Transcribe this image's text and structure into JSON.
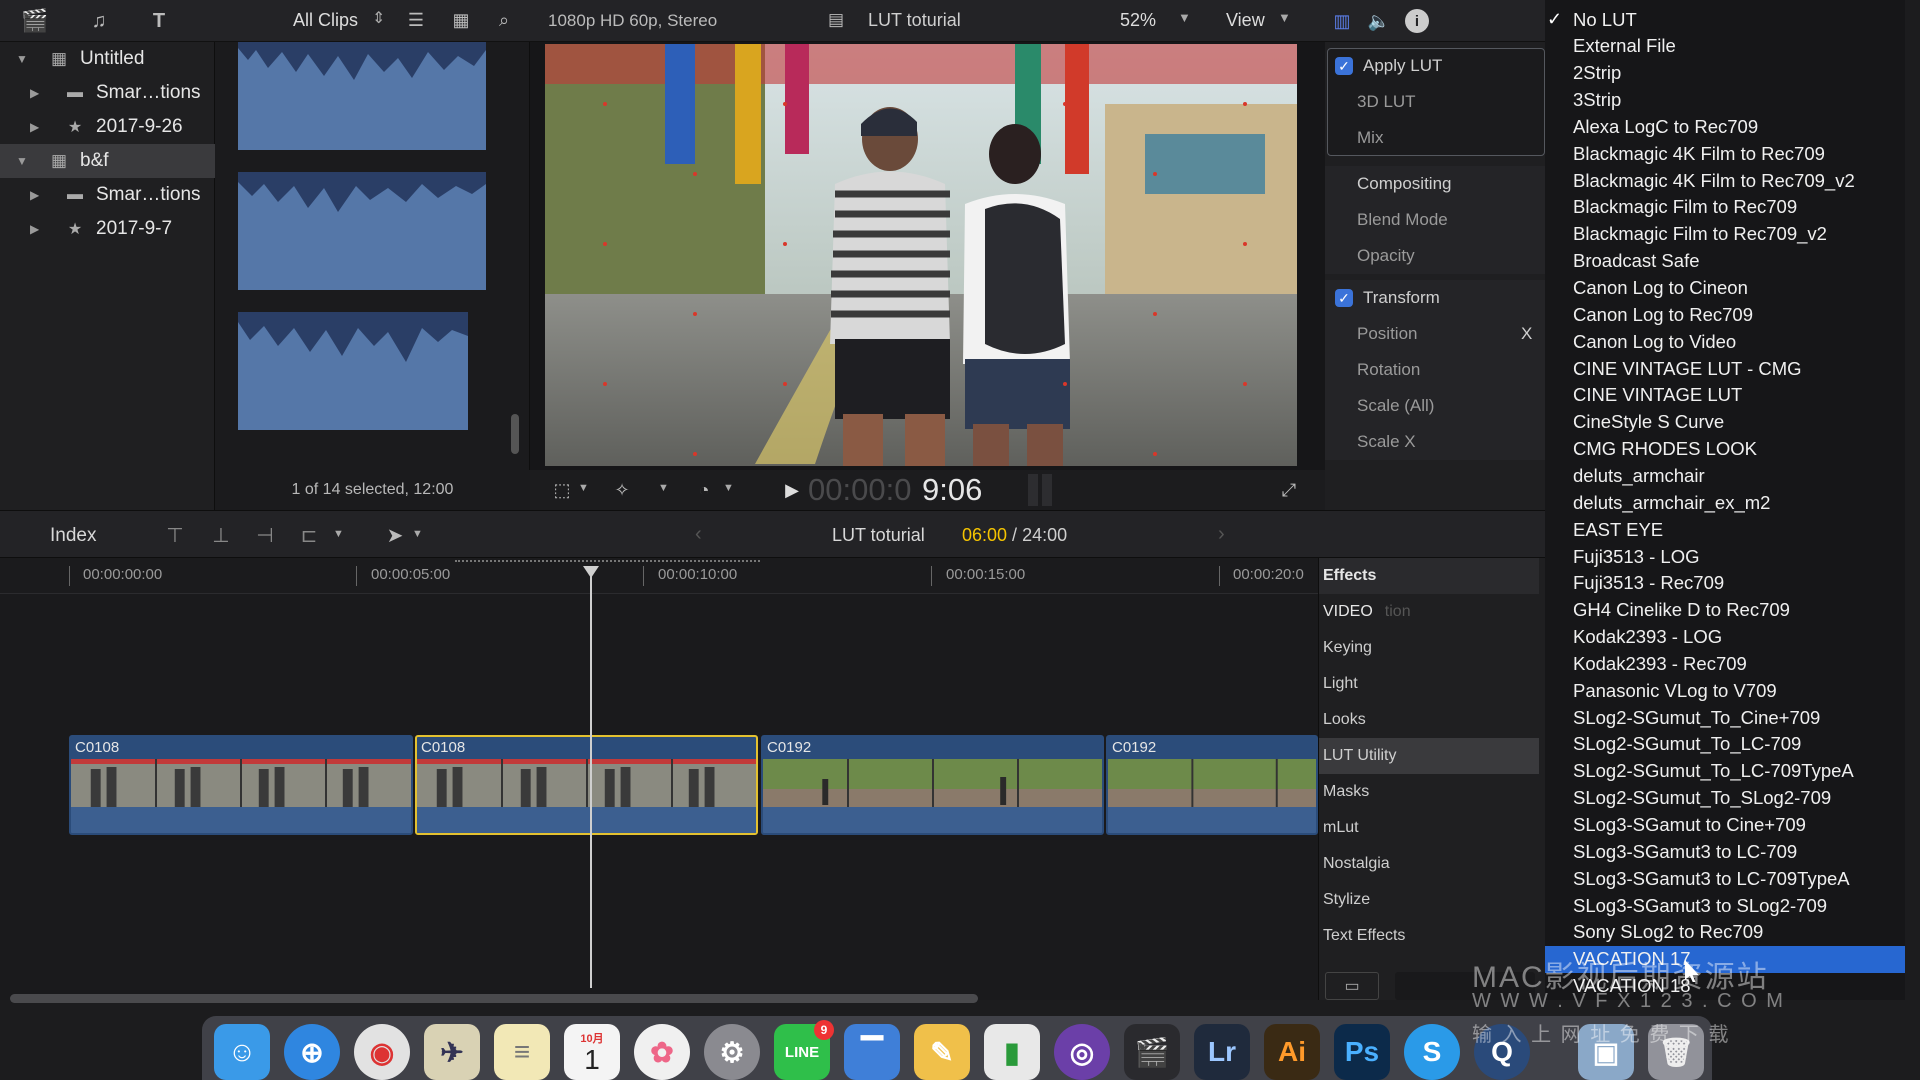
{
  "browser": {
    "filter_label": "All Clips",
    "footer": "1 of 14 selected, 12:00"
  },
  "library": {
    "items": [
      {
        "label": "Untitled",
        "icon": "library-icon"
      },
      {
        "label": "Smar…tions",
        "icon": "folder-icon"
      },
      {
        "label": "2017-9-26",
        "icon": "event-star-icon"
      },
      {
        "label": "b&f",
        "icon": "library-icon"
      },
      {
        "label": "Smar…tions",
        "icon": "folder-icon"
      },
      {
        "label": "2017-9-7",
        "icon": "event-star-icon"
      }
    ]
  },
  "viewer": {
    "format": "1080p HD 60p, Stereo",
    "project": "LUT toturial",
    "zoom": "52%",
    "view_label": "View",
    "timecode_dim": "00:00:0",
    "timecode_bright": "9:06"
  },
  "inspector": {
    "rows": [
      {
        "label": "Apply LUT",
        "checked": true
      },
      {
        "label": "3D LUT"
      },
      {
        "label": "Mix"
      },
      {
        "label": "Compositing"
      },
      {
        "label": "Blend Mode"
      },
      {
        "label": "Opacity"
      },
      {
        "label": "Transform",
        "checked": true
      },
      {
        "label": "Position",
        "value": "X"
      },
      {
        "label": "Rotation"
      },
      {
        "label": "Scale (All)"
      },
      {
        "label": "Scale X"
      }
    ]
  },
  "timeline": {
    "index_label": "Index",
    "project": "LUT toturial",
    "position": "06:00",
    "separator": " / ",
    "duration": "24:00",
    "ticks": [
      "00:00:00:00",
      "00:00:05:00",
      "00:00:10:00",
      "00:00:15:00",
      "00:00:20:0"
    ],
    "clips": [
      {
        "name": "C0108",
        "selected": false
      },
      {
        "name": "C0108",
        "selected": true
      },
      {
        "name": "C0192",
        "selected": false
      },
      {
        "name": "C0192",
        "selected": false
      }
    ]
  },
  "effects": {
    "title": "Effects",
    "section": "VIDEO",
    "ghost": "tion",
    "items": [
      "Keying",
      "Light",
      "Looks",
      "LUT Utility",
      "Masks",
      "mLut",
      "Nostalgia",
      "Stylize",
      "Text Effects"
    ],
    "selected": "LUT Utility"
  },
  "lut_menu": {
    "checked": "No LUT",
    "highlighted": "VACATION 17",
    "items": [
      "No LUT",
      "External File",
      "2Strip",
      "3Strip",
      "Alexa LogC to Rec709",
      "Blackmagic 4K Film to Rec709",
      "Blackmagic 4K Film to Rec709_v2",
      "Blackmagic Film to Rec709",
      "Blackmagic Film to Rec709_v2",
      "Broadcast Safe",
      "Canon Log to Cineon",
      "Canon Log to Rec709",
      "Canon Log to Video",
      "CINE VINTAGE LUT - CMG",
      "CINE VINTAGE LUT",
      "CineStyle S Curve",
      "CMG RHODES LOOK",
      "deluts_armchair",
      "deluts_armchair_ex_m2",
      "EAST EYE",
      "Fuji3513 - LOG",
      "Fuji3513 - Rec709",
      "GH4 Cinelike D to Rec709",
      "Kodak2393 - LOG",
      "Kodak2393 - Rec709",
      "Panasonic VLog to V709",
      "SLog2-SGumut_To_Cine+709",
      "SLog2-SGumut_To_LC-709",
      "SLog2-SGumut_To_LC-709TypeA",
      "SLog2-SGumut_To_SLog2-709",
      "SLog3-SGamut to Cine+709",
      "SLog3-SGamut3 to LC-709",
      "SLog3-SGamut3 to LC-709TypeA",
      "SLog3-SGamut3 to SLog2-709",
      "Sony SLog2 to Rec709",
      "VACATION 17",
      "VACATION 18"
    ]
  },
  "dock": {
    "calendar_month": "10月",
    "calendar_day": "1",
    "line_badge": "9",
    "icons": [
      "finder-icon",
      "safari-icon",
      "chrome-icon",
      "preview-icon",
      "notes-icon",
      "calendar-icon",
      "photos-icon",
      "system-preferences-icon",
      "line-icon",
      "keynote-icon",
      "pages-icon",
      "numbers-icon",
      "motion-icon",
      "final-cut-icon",
      "lightroom-icon",
      "illustrator-icon",
      "photoshop-icon",
      "skype-icon",
      "quicktime-icon",
      "desktop-icon",
      "trash-icon"
    ],
    "lr_label": "Lr",
    "ai_label": "Ai",
    "ps_label": "Ps",
    "s_label": "S"
  },
  "watermark": {
    "line1": "MAC影视后期资源站",
    "line2": "W W W . V F X 1 2 3 . C O M",
    "line3": "输 入 上 网 址 免 费 下 载"
  },
  "colors": {
    "accent": "#2767d1",
    "selection_yellow": "#e3c130",
    "clip_blue": "#2b4c7a",
    "position_yellow": "#f5c400"
  }
}
